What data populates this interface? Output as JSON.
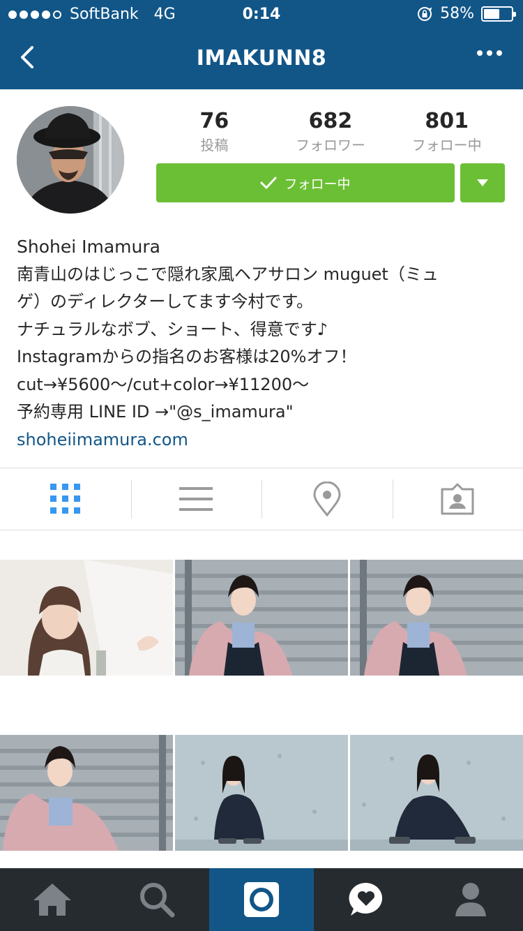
{
  "status_bar": {
    "carrier": "SoftBank",
    "network": "4G",
    "time": "0:14",
    "battery": "58%",
    "battery_level": 0.58
  },
  "nav": {
    "title": "IMAKUNN8"
  },
  "stats": [
    {
      "value": "76",
      "label": "投稿"
    },
    {
      "value": "682",
      "label": "フォロワー"
    },
    {
      "value": "801",
      "label": "フォロー中"
    }
  ],
  "follow_button": {
    "label": "フォロー中"
  },
  "bio": {
    "name": "Shohei Imamura",
    "lines": [
      "南青山のはじっこで隠れ家風ヘアサロン muguet（ミュ",
      "ゲ）のディレクターしてます今村です。",
      "ナチュラルなボブ、ショート、得意です♪",
      "Instagramからの指名のお客様は20%オフ！",
      "cut→¥5600〜/cut+color→¥11200〜",
      "予約専用 LINE ID →\"@s_imamura\""
    ],
    "website": "shoheiimamura.com"
  },
  "profile_tabs": [
    "grid-icon",
    "list-icon",
    "location-pin-icon",
    "tagged-person-icon"
  ],
  "bottom_tabs": [
    "home-icon",
    "search-icon",
    "camera-icon",
    "heart-bubble-icon",
    "profile-icon"
  ],
  "colors": {
    "brand_blue": "#125688",
    "follow_green": "#6bbf34",
    "tabbar_dark": "#262b30",
    "link_blue": "#125688"
  }
}
